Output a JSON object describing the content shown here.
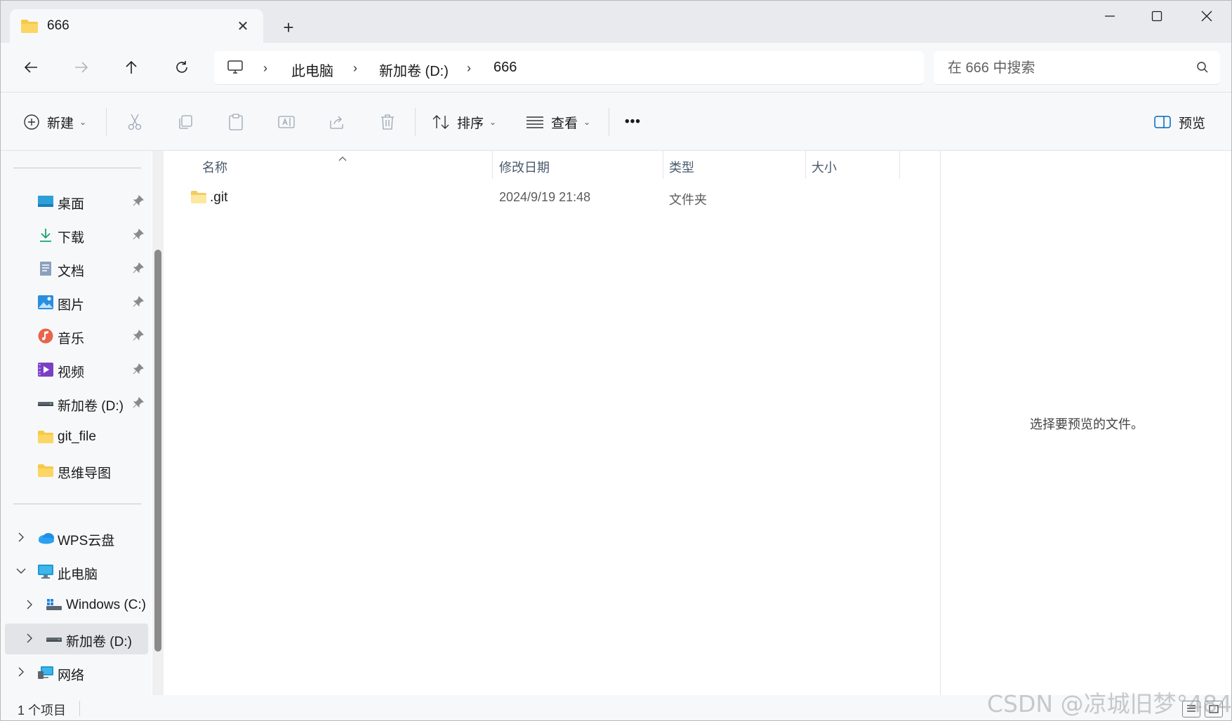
{
  "window": {
    "tab_title": "666",
    "new_tab": "+",
    "close_tab": "✕"
  },
  "breadcrumb": [
    {
      "label": "此电脑"
    },
    {
      "label": "新加卷 (D:)"
    },
    {
      "label": "666"
    }
  ],
  "search": {
    "placeholder": "在 666 中搜索"
  },
  "commands": {
    "new_label": "新建",
    "sort_label": "排序",
    "view_label": "查看",
    "more_label": "•••",
    "preview_label": "预览"
  },
  "sidebar": {
    "quick_access": [
      {
        "label": "桌面",
        "icon": "desktop-icon",
        "pinned": true
      },
      {
        "label": "下载",
        "icon": "download-icon",
        "pinned": true
      },
      {
        "label": "文档",
        "icon": "document-icon",
        "pinned": true
      },
      {
        "label": "图片",
        "icon": "pictures-icon",
        "pinned": true
      },
      {
        "label": "音乐",
        "icon": "music-icon",
        "pinned": true
      },
      {
        "label": "视频",
        "icon": "video-icon",
        "pinned": true
      },
      {
        "label": "新加卷 (D:)",
        "icon": "drive-icon",
        "pinned": true
      },
      {
        "label": "git_file",
        "icon": "folder-icon",
        "pinned": false
      },
      {
        "label": "思维导图",
        "icon": "folder-icon",
        "pinned": false
      }
    ],
    "tree": [
      {
        "label": "WPS云盘",
        "icon": "cloud-icon",
        "expanded": false
      },
      {
        "label": "此电脑",
        "icon": "computer-icon",
        "expanded": true
      },
      {
        "label": "Windows (C:)",
        "icon": "windows-drive-icon",
        "expanded": false
      },
      {
        "label": "新加卷 (D:)",
        "icon": "drive-icon",
        "expanded": false,
        "selected": true
      },
      {
        "label": "网络",
        "icon": "network-icon",
        "expanded": false
      }
    ]
  },
  "columns": {
    "name": "名称",
    "modified": "修改日期",
    "type": "类型",
    "size": "大小"
  },
  "files": [
    {
      "name": ".git",
      "modified": "2024/9/19 21:48",
      "type": "文件夹",
      "size": ""
    }
  ],
  "preview_pane": {
    "message": "选择要预览的文件。"
  },
  "status": {
    "item_count": "1 个项目"
  },
  "watermark": "CSDN @凉城旧梦°484",
  "colors": {
    "folder": "#f7c948",
    "accent": "#0067c0",
    "chrome_bg": "#f7f8fa",
    "selected_bg": "#e3e4e7"
  }
}
